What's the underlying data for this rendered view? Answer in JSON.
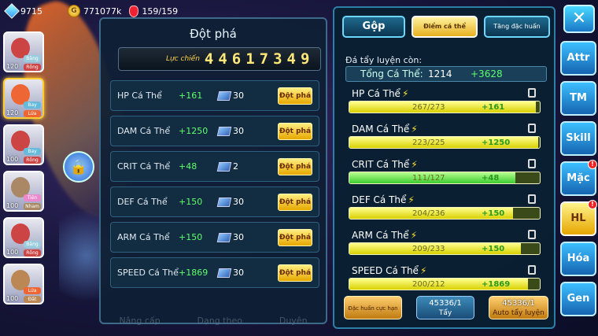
{
  "topbar": {
    "gems": "9715",
    "coins": "771077k",
    "stamina": "159/159"
  },
  "roster": [
    {
      "level": "120",
      "tags": [
        "Băng",
        "Rồng"
      ],
      "colors": [
        "#9cd",
        "#c44"
      ]
    },
    {
      "level": "120",
      "tags": [
        "Bay",
        "Lửa"
      ],
      "colors": [
        "#6bd",
        "#e63"
      ]
    },
    {
      "level": "100",
      "tags": [
        "Bay",
        "Rồng"
      ],
      "colors": [
        "#6bd",
        "#c44"
      ]
    },
    {
      "level": "100",
      "tags": [
        "Tiên",
        "Nham"
      ],
      "colors": [
        "#e8c",
        "#a86"
      ]
    },
    {
      "level": "100",
      "tags": [
        "Băng",
        "Rồng"
      ],
      "colors": [
        "#9cd",
        "#c44"
      ]
    },
    {
      "level": "100",
      "tags": [
        "Lửa",
        "Đất"
      ],
      "colors": [
        "#e63",
        "#b85"
      ]
    }
  ],
  "breakthrough": {
    "title": "Đột phá",
    "power_label": "Lực chiến",
    "power_value": "44617349",
    "rows": [
      {
        "name": "HP Cá Thể",
        "inc": "+161",
        "qty": "30",
        "button": "Đột phá"
      },
      {
        "name": "DAM Cá Thể",
        "inc": "+1250",
        "qty": "30",
        "button": "Đột phá"
      },
      {
        "name": "CRIT Cá Thể",
        "inc": "+48",
        "qty": "2",
        "button": "Đột phá"
      },
      {
        "name": "DEF Cá Thể",
        "inc": "+150",
        "qty": "30",
        "button": "Đột phá"
      },
      {
        "name": "ARM Cá Thể",
        "inc": "+150",
        "qty": "30",
        "button": "Đột phá"
      },
      {
        "name": "SPEED Cá Thể",
        "inc": "+1869",
        "qty": "30",
        "button": "Đột phá"
      }
    ],
    "footer": [
      "Nâng cấp",
      "Dạng theo",
      "Duyên"
    ]
  },
  "training": {
    "tabs": [
      "Gộp",
      "Điểm cá thể",
      "Tăng đặc huấn"
    ],
    "remaining_label": "Đá tẩy luyện còn:",
    "total": {
      "label": "Tổng Cá Thể:",
      "value": "1214",
      "bonus": "+3628"
    },
    "stats": [
      {
        "name": "HP Cá Thể",
        "current": "267/273",
        "plus": "+161",
        "fill": 0.98,
        "green": false
      },
      {
        "name": "DAM Cá Thể",
        "current": "223/225",
        "plus": "+1250",
        "fill": 0.99,
        "green": false
      },
      {
        "name": "CRIT Cá Thể",
        "current": "111/127",
        "plus": "+48",
        "fill": 0.87,
        "green": true
      },
      {
        "name": "DEF Cá Thể",
        "current": "204/236",
        "plus": "+150",
        "fill": 0.86,
        "green": false
      },
      {
        "name": "ARM Cá Thể",
        "current": "209/233",
        "plus": "+150",
        "fill": 0.9,
        "green": false
      },
      {
        "name": "SPEED Cá Thể",
        "current": "200/212",
        "plus": "+1869",
        "fill": 0.94,
        "green": false
      }
    ],
    "bottom": {
      "special": "Đặc huấn cực hạn",
      "wash_count": "45336/1",
      "wash_label": "Tẩy",
      "auto_count": "45336/1",
      "auto_label": "Auto tẩy luyện"
    }
  },
  "side_menu": {
    "close": "✕",
    "items": [
      {
        "label": "Attr",
        "badge": false,
        "active": false
      },
      {
        "label": "TM",
        "badge": false,
        "active": false
      },
      {
        "label": "Skill",
        "badge": false,
        "active": false
      },
      {
        "label": "Mặc",
        "badge": true,
        "active": false
      },
      {
        "label": "HL",
        "badge": true,
        "active": true
      },
      {
        "label": "Hóa",
        "badge": false,
        "active": false
      },
      {
        "label": "Gen",
        "badge": false,
        "active": false
      }
    ],
    "badge_text": "!"
  }
}
